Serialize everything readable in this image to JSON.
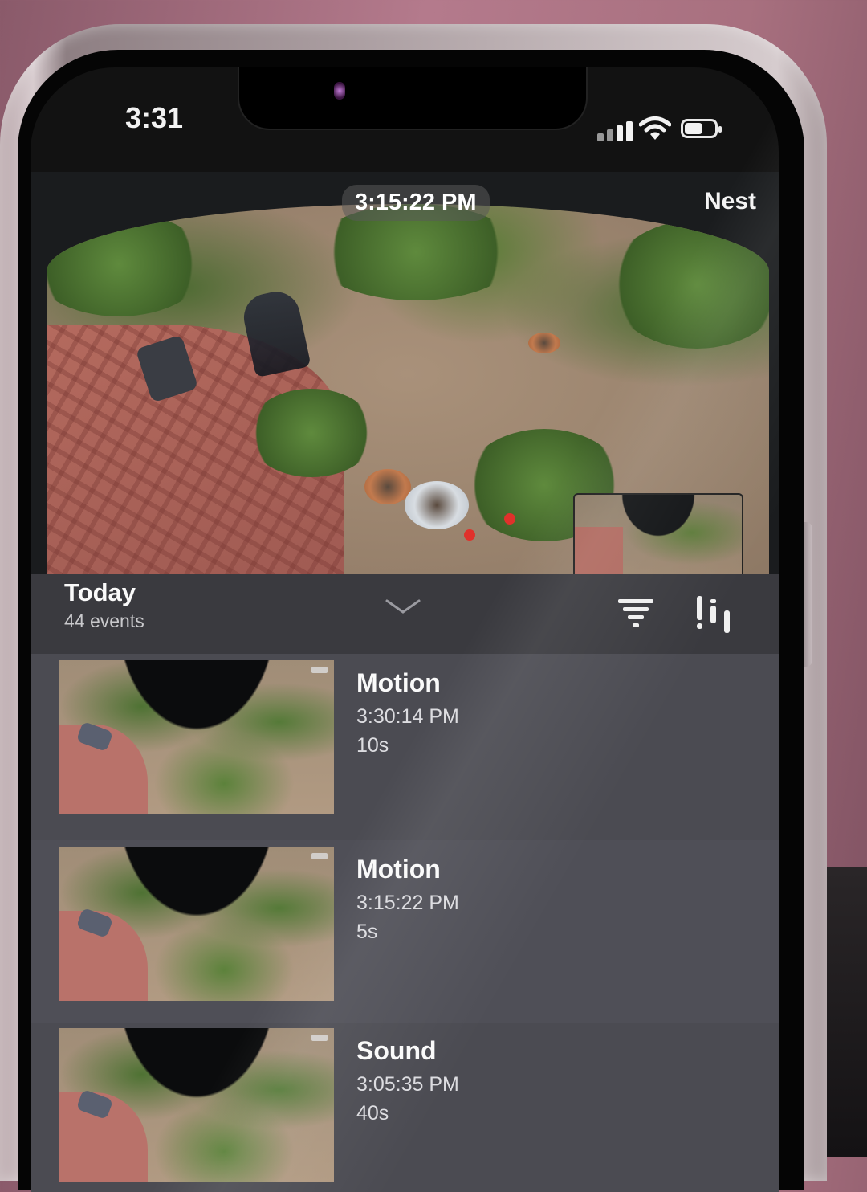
{
  "status_bar": {
    "time": "3:31"
  },
  "camera": {
    "timestamp": "3:15:22 PM",
    "brand": "Nest"
  },
  "events_header": {
    "day": "Today",
    "count": "44 events"
  },
  "icons": {
    "signal": "cellular-signal-icon",
    "wifi": "wifi-icon",
    "battery": "battery-icon",
    "collapse": "chevron-down-icon",
    "filter": "filter-icon",
    "timeline": "timeline-icon"
  },
  "events": [
    {
      "type": "Motion",
      "time": "3:30:14 PM",
      "duration": "10s"
    },
    {
      "type": "Motion",
      "time": "3:15:22 PM",
      "duration": "5s"
    },
    {
      "type": "Sound",
      "time": "3:05:35 PM",
      "duration": "40s"
    }
  ]
}
